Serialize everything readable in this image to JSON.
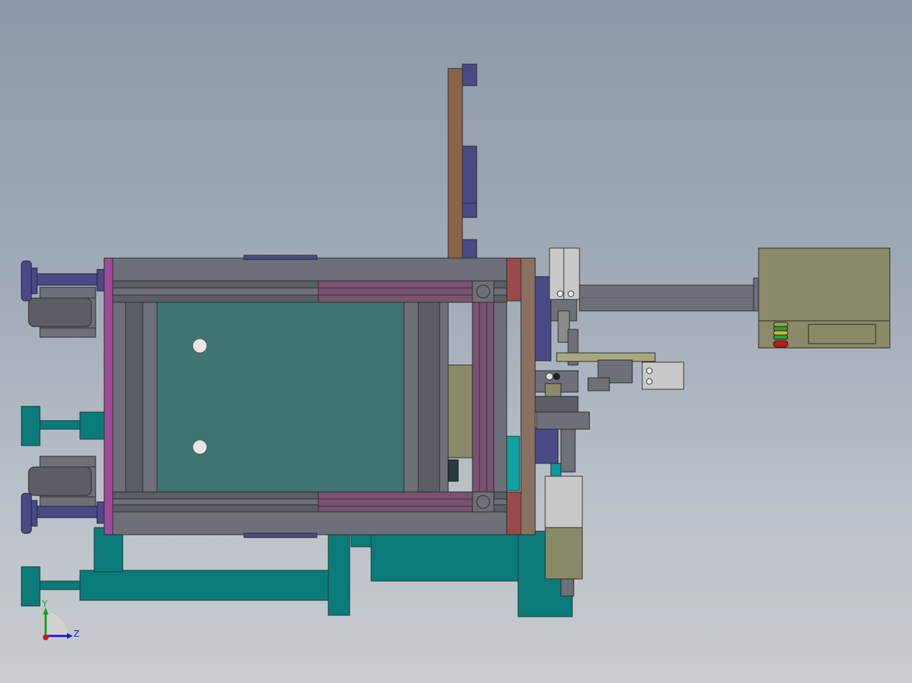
{
  "viewport": {
    "background_top": "#8b99aa",
    "background_bottom": "#c9ccd0"
  },
  "model": {
    "colors": {
      "frame": "#6e7079",
      "frame_dark": "#4f5158",
      "panel": "#3e7572",
      "base": "#0a7b78",
      "purple_rail": "#7a5370",
      "navy": "#4a4a86",
      "brown": "#8a6447",
      "olive": "#8a8a68",
      "red_block": "#9a4a4a"
    },
    "icons": [
      "wheel-icon",
      "caster-icon",
      "cylinder-icon",
      "signal-lamp-icon",
      "hole-icon"
    ]
  },
  "triad": {
    "y_label": "Y",
    "z_label": "Z",
    "y_color": "#18a018",
    "z_color": "#1a1acc",
    "x_color": "#cc1a1a"
  }
}
